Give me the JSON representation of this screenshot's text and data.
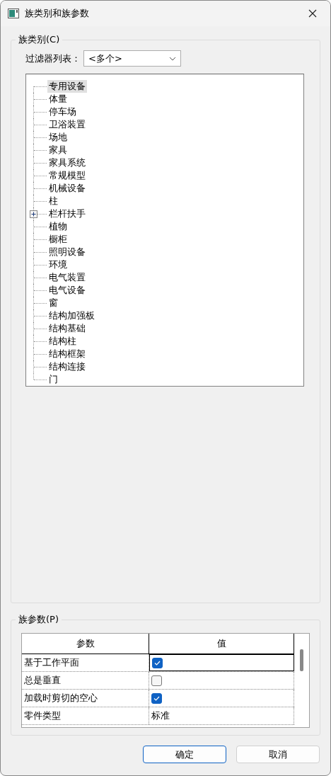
{
  "window": {
    "title": "族类别和族参数"
  },
  "category_group": {
    "title": "族类别(C)",
    "filter": {
      "label": "过滤器列表：",
      "value": "<多个>"
    },
    "tree": [
      {
        "label": "专用设备",
        "selected": true,
        "kind": "leaf"
      },
      {
        "label": "体量",
        "selected": false,
        "kind": "leaf"
      },
      {
        "label": "停车场",
        "selected": false,
        "kind": "leaf"
      },
      {
        "label": "卫浴装置",
        "selected": false,
        "kind": "leaf"
      },
      {
        "label": "场地",
        "selected": false,
        "kind": "leaf"
      },
      {
        "label": "家具",
        "selected": false,
        "kind": "leaf"
      },
      {
        "label": "家具系统",
        "selected": false,
        "kind": "leaf"
      },
      {
        "label": "常规模型",
        "selected": false,
        "kind": "leaf"
      },
      {
        "label": "机械设备",
        "selected": false,
        "kind": "leaf"
      },
      {
        "label": "柱",
        "selected": false,
        "kind": "leaf"
      },
      {
        "label": "栏杆扶手",
        "selected": false,
        "kind": "collapsed"
      },
      {
        "label": "植物",
        "selected": false,
        "kind": "leaf"
      },
      {
        "label": "橱柜",
        "selected": false,
        "kind": "leaf"
      },
      {
        "label": "照明设备",
        "selected": false,
        "kind": "leaf"
      },
      {
        "label": "环境",
        "selected": false,
        "kind": "leaf"
      },
      {
        "label": "电气装置",
        "selected": false,
        "kind": "leaf"
      },
      {
        "label": "电气设备",
        "selected": false,
        "kind": "leaf"
      },
      {
        "label": "窗",
        "selected": false,
        "kind": "leaf"
      },
      {
        "label": "结构加强板",
        "selected": false,
        "kind": "leaf"
      },
      {
        "label": "结构基础",
        "selected": false,
        "kind": "leaf"
      },
      {
        "label": "结构柱",
        "selected": false,
        "kind": "leaf"
      },
      {
        "label": "结构框架",
        "selected": false,
        "kind": "leaf"
      },
      {
        "label": "结构连接",
        "selected": false,
        "kind": "leaf"
      },
      {
        "label": "门",
        "selected": false,
        "kind": "leaf"
      }
    ]
  },
  "parameter_group": {
    "title": "族参数(P)",
    "columns": [
      "参数",
      "值"
    ],
    "rows": [
      {
        "parameter": "基于工作平面",
        "kind": "checkbox",
        "checked": true,
        "selected": true
      },
      {
        "parameter": "总是垂直",
        "kind": "checkbox",
        "checked": false,
        "selected": false
      },
      {
        "parameter": "加载时剪切的空心",
        "kind": "checkbox",
        "checked": true,
        "selected": false
      },
      {
        "parameter": "零件类型",
        "kind": "text",
        "value": "标准",
        "selected": false
      }
    ]
  },
  "buttons": [
    {
      "label": "确定",
      "default": true
    },
    {
      "label": "取消",
      "default": false
    }
  ]
}
